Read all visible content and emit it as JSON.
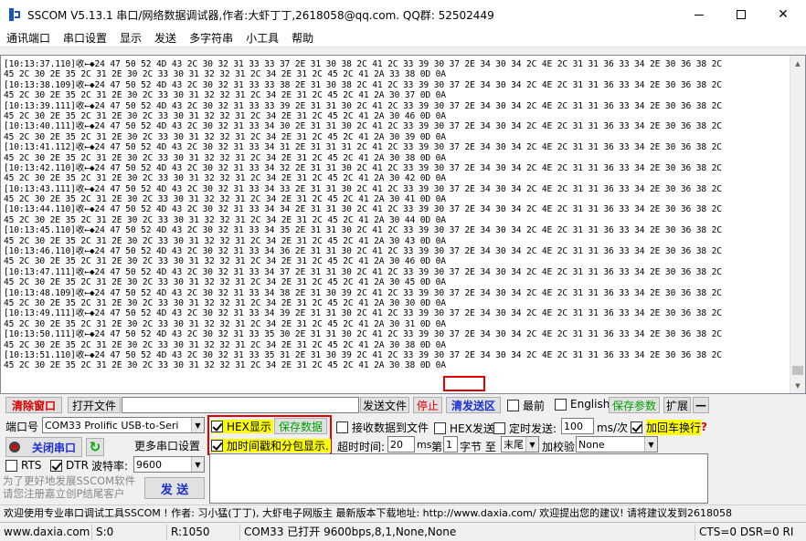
{
  "window": {
    "title": "SSCOM V5.13.1 串口/网络数据调试器,作者:大虾丁丁,2618058@qq.com. QQ群: 52502449"
  },
  "menu": [
    "通讯端口",
    "串口设置",
    "显示",
    "发送",
    "多字符串",
    "小工具",
    "帮助"
  ],
  "receive": {
    "lines": [
      "[10:13:37.110]收←◆24 47 50 52 4D 43 2C 30 32 31 33 33 37 2E 31 30 38 2C 41 2C 33 39 30 37 2E 34 30 34 2C 4E 2C 31 31 36 33 34 2E 30 36 38 2C",
      "45 2C 30 2E 35 2C 31 2E 30 2C 33 30 31 32 32 31 2C 34 2E 31 2C 45 2C 41 2A 33 38 0D 0A",
      "[10:13:38.109]收←◆24 47 50 52 4D 43 2C 30 32 31 33 33 38 2E 31 30 38 2C 41 2C 33 39 30 37 2E 34 30 34 2C 4E 2C 31 31 36 33 34 2E 30 36 38 2C",
      "45 2C 30 2E 35 2C 31 2E 30 2C 33 30 31 32 32 31 2C 34 2E 31 2C 45 2C 41 2A 30 37 0D 0A",
      "[10:13:39.111]收←◆24 47 50 52 4D 43 2C 30 32 31 33 33 39 2E 31 31 30 2C 41 2C 33 39 30 37 2E 34 30 34 2C 4E 2C 31 31 36 33 34 2E 30 36 38 2C",
      "45 2C 30 2E 35 2C 31 2E 30 2C 33 30 31 32 32 31 2C 34 2E 31 2C 45 2C 41 2A 30 46 0D 0A",
      "[10:13:40.111]收←◆24 47 50 52 4D 43 2C 30 32 31 33 34 30 2E 31 31 30 2C 41 2C 33 39 30 37 2E 34 30 34 2C 4E 2C 31 31 36 33 34 2E 30 36 38 2C",
      "45 2C 30 2E 35 2C 31 2E 30 2C 33 30 31 32 32 31 2C 34 2E 31 2C 45 2C 41 2A 30 39 0D 0A",
      "[10:13:41.112]收←◆24 47 50 52 4D 43 2C 30 32 31 33 34 31 2E 31 31 31 2C 41 2C 33 39 30 37 2E 34 30 34 2C 4E 2C 31 31 36 33 34 2E 30 36 38 2C",
      "45 2C 30 2E 35 2C 31 2E 30 2C 33 30 31 32 32 31 2C 34 2E 31 2C 45 2C 41 2A 30 38 0D 0A",
      "[10:13:42.110]收←◆24 47 50 52 4D 43 2C 30 32 31 33 34 32 2E 31 31 30 2C 41 2C 33 39 30 37 2E 34 30 34 2C 4E 2C 31 31 36 33 34 2E 30 36 38 2C",
      "45 2C 30 2E 35 2C 31 2E 30 2C 33 30 31 32 32 31 2C 34 2E 31 2C 45 2C 41 2A 30 42 0D 0A",
      "[10:13:43.111]收←◆24 47 50 52 4D 43 2C 30 32 31 33 34 33 2E 31 31 30 2C 41 2C 33 39 30 37 2E 34 30 34 2C 4E 2C 31 31 36 33 34 2E 30 36 38 2C",
      "45 2C 30 2E 35 2C 31 2E 30 2C 33 30 31 32 32 31 2C 34 2E 31 2C 45 2C 41 2A 30 41 0D 0A",
      "[10:13:44.110]收←◆24 47 50 52 4D 43 2C 30 32 31 33 34 34 2E 31 31 30 2C 41 2C 33 39 30 37 2E 34 30 34 2C 4E 2C 31 31 36 33 34 2E 30 36 38 2C",
      "45 2C 30 2E 35 2C 31 2E 30 2C 33 30 31 32 32 31 2C 34 2E 31 2C 45 2C 41 2A 30 44 0D 0A",
      "[10:13:45.110]收←◆24 47 50 52 4D 43 2C 30 32 31 33 34 35 2E 31 31 30 2C 41 2C 33 39 30 37 2E 34 30 34 2C 4E 2C 31 31 36 33 34 2E 30 36 38 2C",
      "45 2C 30 2E 35 2C 31 2E 30 2C 33 30 31 32 32 31 2C 34 2E 31 2C 45 2C 41 2A 30 43 0D 0A",
      "[10:13:46.110]收←◆24 47 50 52 4D 43 2C 30 32 31 33 34 36 2E 31 31 30 2C 41 2C 33 39 30 37 2E 34 30 34 2C 4E 2C 31 31 36 33 34 2E 30 36 38 2C",
      "45 2C 30 2E 35 2C 31 2E 30 2C 33 30 31 32 32 31 2C 34 2E 31 2C 45 2C 41 2A 30 46 0D 0A",
      "[10:13:47.111]收←◆24 47 50 52 4D 43 2C 30 32 31 33 34 37 2E 31 31 30 2C 41 2C 33 39 30 37 2E 34 30 34 2C 4E 2C 31 31 36 33 34 2E 30 36 38 2C",
      "45 2C 30 2E 35 2C 31 2E 30 2C 33 30 31 32 32 31 2C 34 2E 31 2C 45 2C 41 2A 30 45 0D 0A",
      "[10:13:48.109]收←◆24 47 50 52 4D 43 2C 30 32 31 33 34 38 2E 31 30 39 2C 41 2C 33 39 30 37 2E 34 30 34 2C 4E 2C 31 31 36 33 34 2E 30 36 38 2C",
      "45 2C 30 2E 35 2C 31 2E 30 2C 33 30 31 32 32 31 2C 34 2E 31 2C 45 2C 41 2A 30 30 0D 0A",
      "[10:13:49.111]收←◆24 47 50 52 4D 43 2C 30 32 31 33 34 39 2E 31 31 30 2C 41 2C 33 39 30 37 2E 34 30 34 2C 4E 2C 31 31 36 33 34 2E 30 36 38 2C",
      "45 2C 30 2E 35 2C 31 2E 30 2C 33 30 31 32 32 31 2C 34 2E 31 2C 45 2C 41 2A 30 31 0D 0A",
      "[10:13:50.111]收←◆24 47 50 52 4D 43 2C 30 32 31 33 35 30 2E 31 31 30 2C 41 2C 33 39 30 37 2E 34 30 34 2C 4E 2C 31 31 36 33 34 2E 30 36 38 2C",
      "45 2C 30 2E 35 2C 31 2E 30 2C 33 30 31 32 32 31 2C 34 2E 31 2C 45 2C 41 2A 30 38 0D 0A",
      "[10:13:51.110]收←◆24 47 50 52 4D 43 2C 30 32 31 33 35 31 2E 31 30 39 2C 41 2C 33 39 30 37 2E 34 30 34 2C 4E 2C 31 31 36 33 34 2E 30 36 38 2C",
      "45 2C 30 2E 35 2C 31 2E 30 2C 33 30 31 32 32 31 2C 34 2E 31 2C 45 2C 41 2A 30 38 0D 0A"
    ]
  },
  "toolbar": {
    "clear_window": "清除窗口",
    "open_file": "打开文件",
    "send_file": "发送文件",
    "stop": "停止",
    "clear_send": "清发送区",
    "front_most": "最前",
    "english": "English",
    "save_params": "保存参数",
    "expand": "扩展",
    "collapse": "—"
  },
  "port": {
    "label": "端口号",
    "selected": "COM33 Prolific USB-to-Seri",
    "close_port": "关闭串口",
    "more_settings": "更多串口设置",
    "rts": "RTS",
    "dtr": "DTR",
    "baud_label": "波特率:",
    "baud": "9600"
  },
  "options": {
    "hex_display": "HEX显示",
    "save_data": "保存数据",
    "recv_to_file": "接收数据到文件",
    "hex_send": "HEX发送",
    "timed_send": "定时发送:",
    "timed_value": "100",
    "timed_unit": "ms/次",
    "add_crlf": "加回车换行",
    "timestamp": "加时间戳和分包显示.",
    "timeout_label": "超时时间:",
    "timeout_value": "20",
    "timeout_unit": "ms",
    "byte_label_1": "第",
    "byte_value": "1",
    "byte_label_2": "字节 至",
    "end_select": "末尾",
    "checksum_label": "加校验",
    "checksum_value": "None",
    "help_mark": "?"
  },
  "send": {
    "button": "发 送",
    "promo_1": "为了更好地发展SSCOM软件",
    "promo_2": "请您注册嘉立创P结尾客户"
  },
  "info": {
    "text": "欢迎使用专业串口调试工具SSCOM !   作者: 习小猛(丁丁), 大虾电子网版主   最新版本下载地址: http://www.daxia.com/  欢迎提出您的建议! 请将建议发到2618058"
  },
  "status": {
    "site": "www.daxia.com",
    "sent": "S:0",
    "received": "R:1050",
    "port_state": "COM33 已打开  9600bps,8,1,None,None",
    "signals": "CTS=0 DSR=0 RI"
  }
}
